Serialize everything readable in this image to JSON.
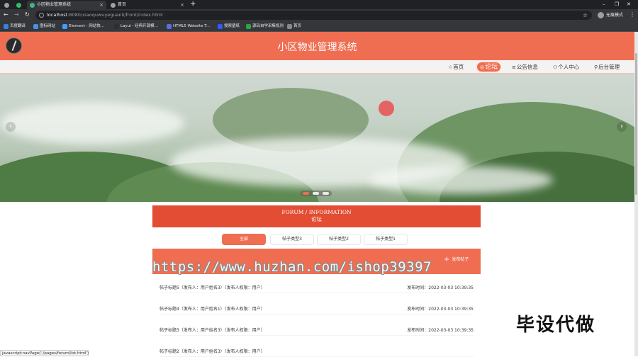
{
  "browser": {
    "tabs": [
      {
        "title": "",
        "active": false
      },
      {
        "title": "小区物业管理系统",
        "active": true
      },
      {
        "title": "首页",
        "active": false
      }
    ],
    "new_tab_label": "+",
    "url_host": "localhost",
    "url_path": ":8080/xiaoquwuyeguanli/front/index.html",
    "profile_label": "无痕模式",
    "bookmarks": [
      {
        "label": "百度翻译",
        "color": "#3b7de0"
      },
      {
        "label": "图标网站",
        "color": "#4a90e2"
      },
      {
        "label": "Element - 网站快...",
        "color": "#409eff"
      },
      {
        "label": "Layui - 经典开源模...",
        "color": "#2f2f2f"
      },
      {
        "label": "HTML5 Website T...",
        "color": "#5b6ee1"
      },
      {
        "label": "搜索壁纸",
        "color": "#2b5cff"
      },
      {
        "label": "源码自学采集规则",
        "color": "#29a745"
      },
      {
        "label": "首页",
        "color": "#888888"
      }
    ]
  },
  "site": {
    "title": "小区物业管理系统",
    "nav": [
      {
        "label": "首页",
        "icon": "☆",
        "active": false
      },
      {
        "label": "论坛",
        "icon": "◎",
        "active": true
      },
      {
        "label": "公告信息",
        "icon": "≡",
        "active": false
      },
      {
        "label": "个人中心",
        "icon": "⚇",
        "active": false
      },
      {
        "label": "后台管理",
        "icon": "⚲",
        "active": false
      }
    ],
    "carousel": {
      "prev": "‹",
      "next": "›",
      "active_index": 0
    }
  },
  "forum": {
    "heading_en": "FORUM / INFORMATION",
    "heading_cn": "论坛",
    "filters": [
      "全部",
      "帖子类型3",
      "帖子类型2",
      "帖子类型1"
    ],
    "post_button": "发布帖子",
    "posts": [
      {
        "title": "帖子标题5（发布人：用户姓名3）（发布人权限：用户）",
        "time": "发布时间：2022-03-03 10:39:35"
      },
      {
        "title": "帖子标题4（发布人：用户姓名1）（发布人权限：用户）",
        "time": "发布时间：2022-03-03 10:39:35"
      },
      {
        "title": "帖子标题3（发布人：用户姓名3）（发布人权限：用户）",
        "time": "发布时间：2022-03-03 10:39:35"
      },
      {
        "title": "帖子标题2（发布人：用户姓名3）（发布人权限：用户）",
        "time": ""
      }
    ]
  },
  "overlay": {
    "watermark_url": "https://www.huzhan.com/ishop39397",
    "watermark_text": "毕设代做",
    "status_url": "javascript:navPage('./pages/forum/list.html')"
  },
  "colors": {
    "brand": "#ef6e52",
    "heading": "#e24d33"
  }
}
